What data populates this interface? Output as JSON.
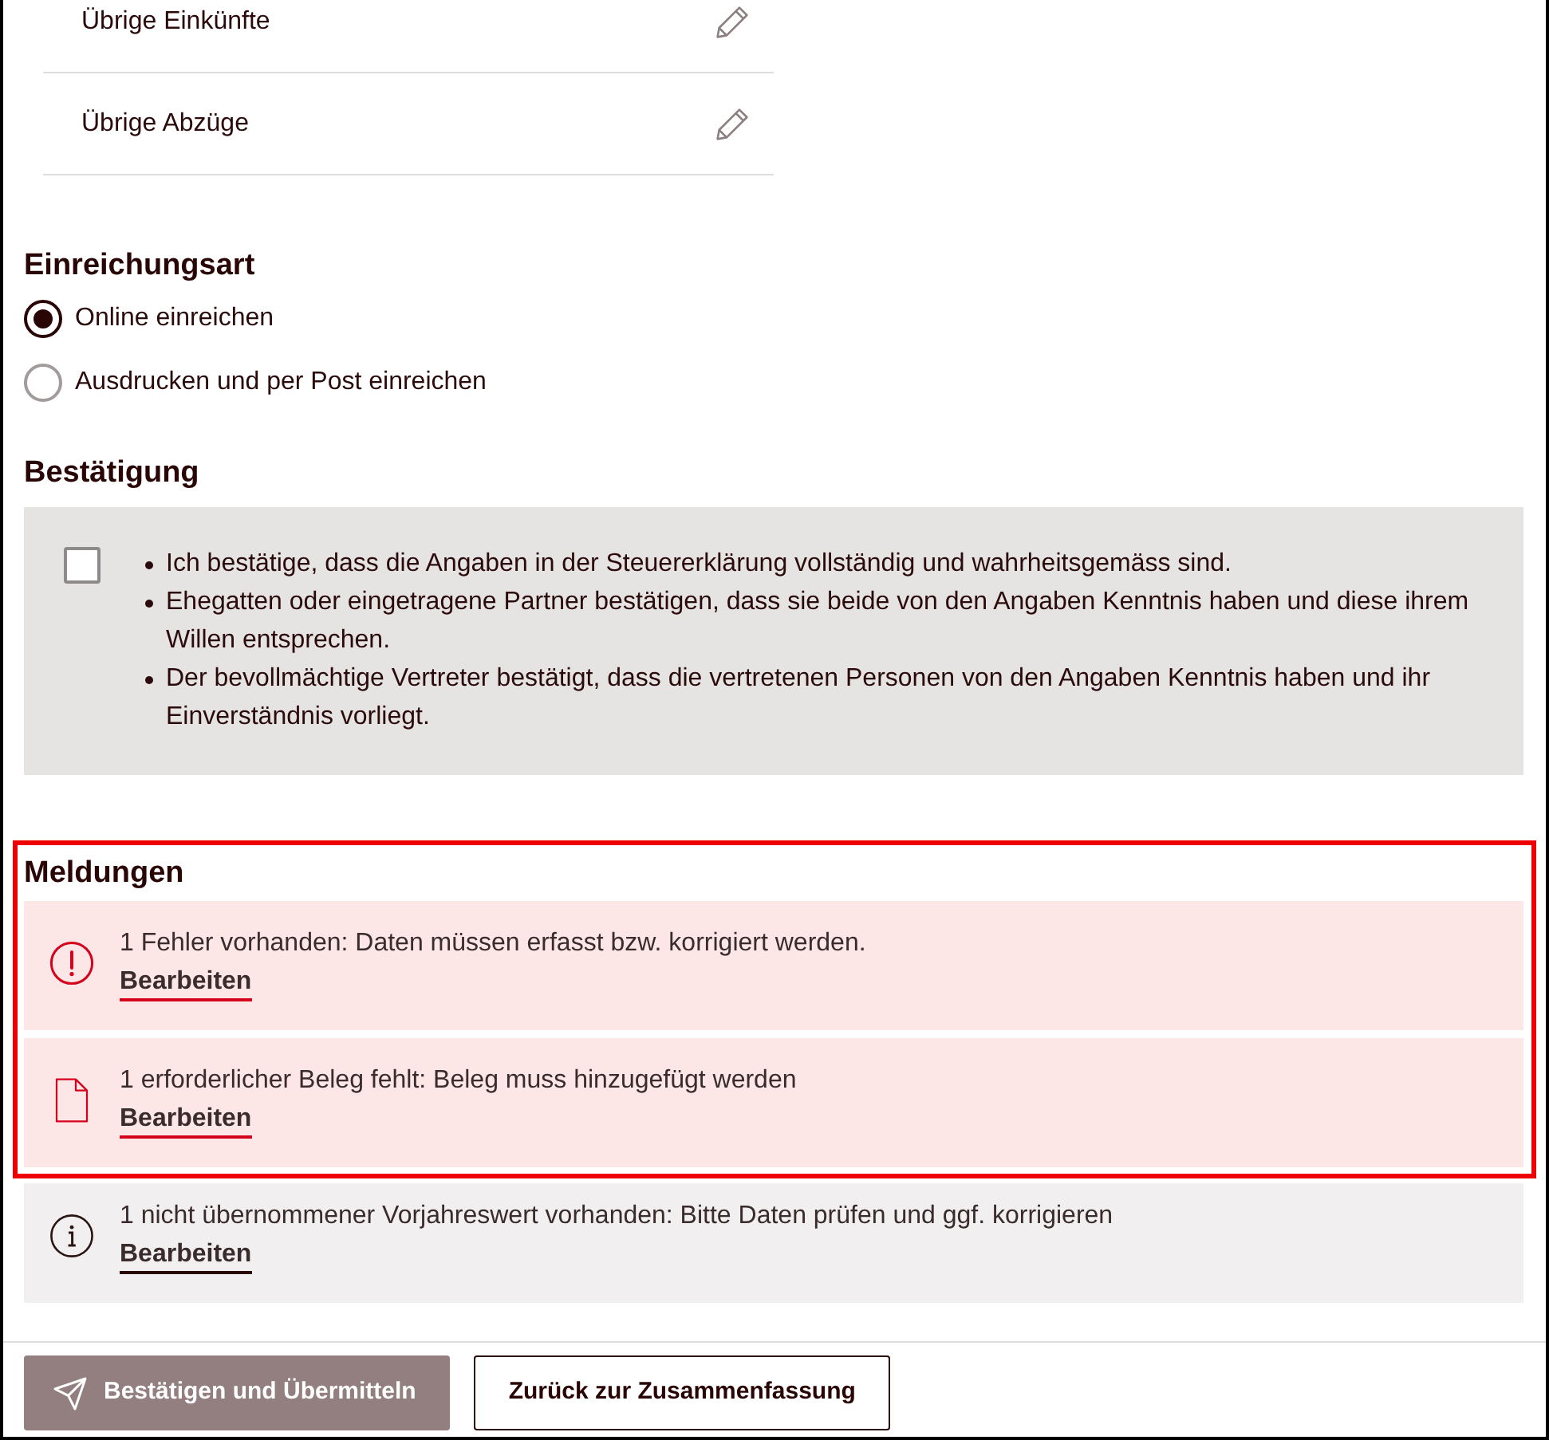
{
  "overview_items": [
    {
      "label": "Übrige Einkünfte"
    },
    {
      "label": "Übrige Abzüge"
    }
  ],
  "submission": {
    "title": "Einreichungsart",
    "options": [
      {
        "label": "Online einreichen",
        "selected": true
      },
      {
        "label": "Ausdrucken und per Post einreichen",
        "selected": false
      }
    ]
  },
  "confirmation": {
    "title": "Bestätigung",
    "checked": false,
    "statements": [
      "Ich bestätige, dass die Angaben in der Steuererklärung vollständig und wahrheitsgemäss sind.",
      "Ehegatten oder eingetragene Partner bestätigen, dass sie beide von den Angaben Kenntnis haben und diese ihrem Willen entsprechen.",
      "Der bevollmächtige Vertreter bestätigt, dass die vertretenen Personen von den Angaben Kenntnis haben und ihr Einverständnis vorliegt."
    ]
  },
  "messages": {
    "title": "Meldungen",
    "items": [
      {
        "kind": "error",
        "text": "1 Fehler vorhanden: Daten müssen erfasst bzw. korrigiert werden.",
        "link": "Bearbeiten",
        "highlighted": true
      },
      {
        "kind": "document",
        "text": "1 erforderlicher Beleg fehlt: Beleg muss hinzugefügt werden",
        "link": "Bearbeiten",
        "highlighted": true
      },
      {
        "kind": "info",
        "text": "1 nicht übernommener Vorjahreswert vorhanden: Bitte Daten prüfen und ggf. korrigieren",
        "link": "Bearbeiten",
        "highlighted": false
      }
    ]
  },
  "actions": [
    {
      "kind": "primary",
      "label": "Bestätigen und Übermitteln",
      "disabled": true
    },
    {
      "kind": "secondary",
      "label": "Zurück zur Zusammenfassung",
      "disabled": false
    }
  ]
}
